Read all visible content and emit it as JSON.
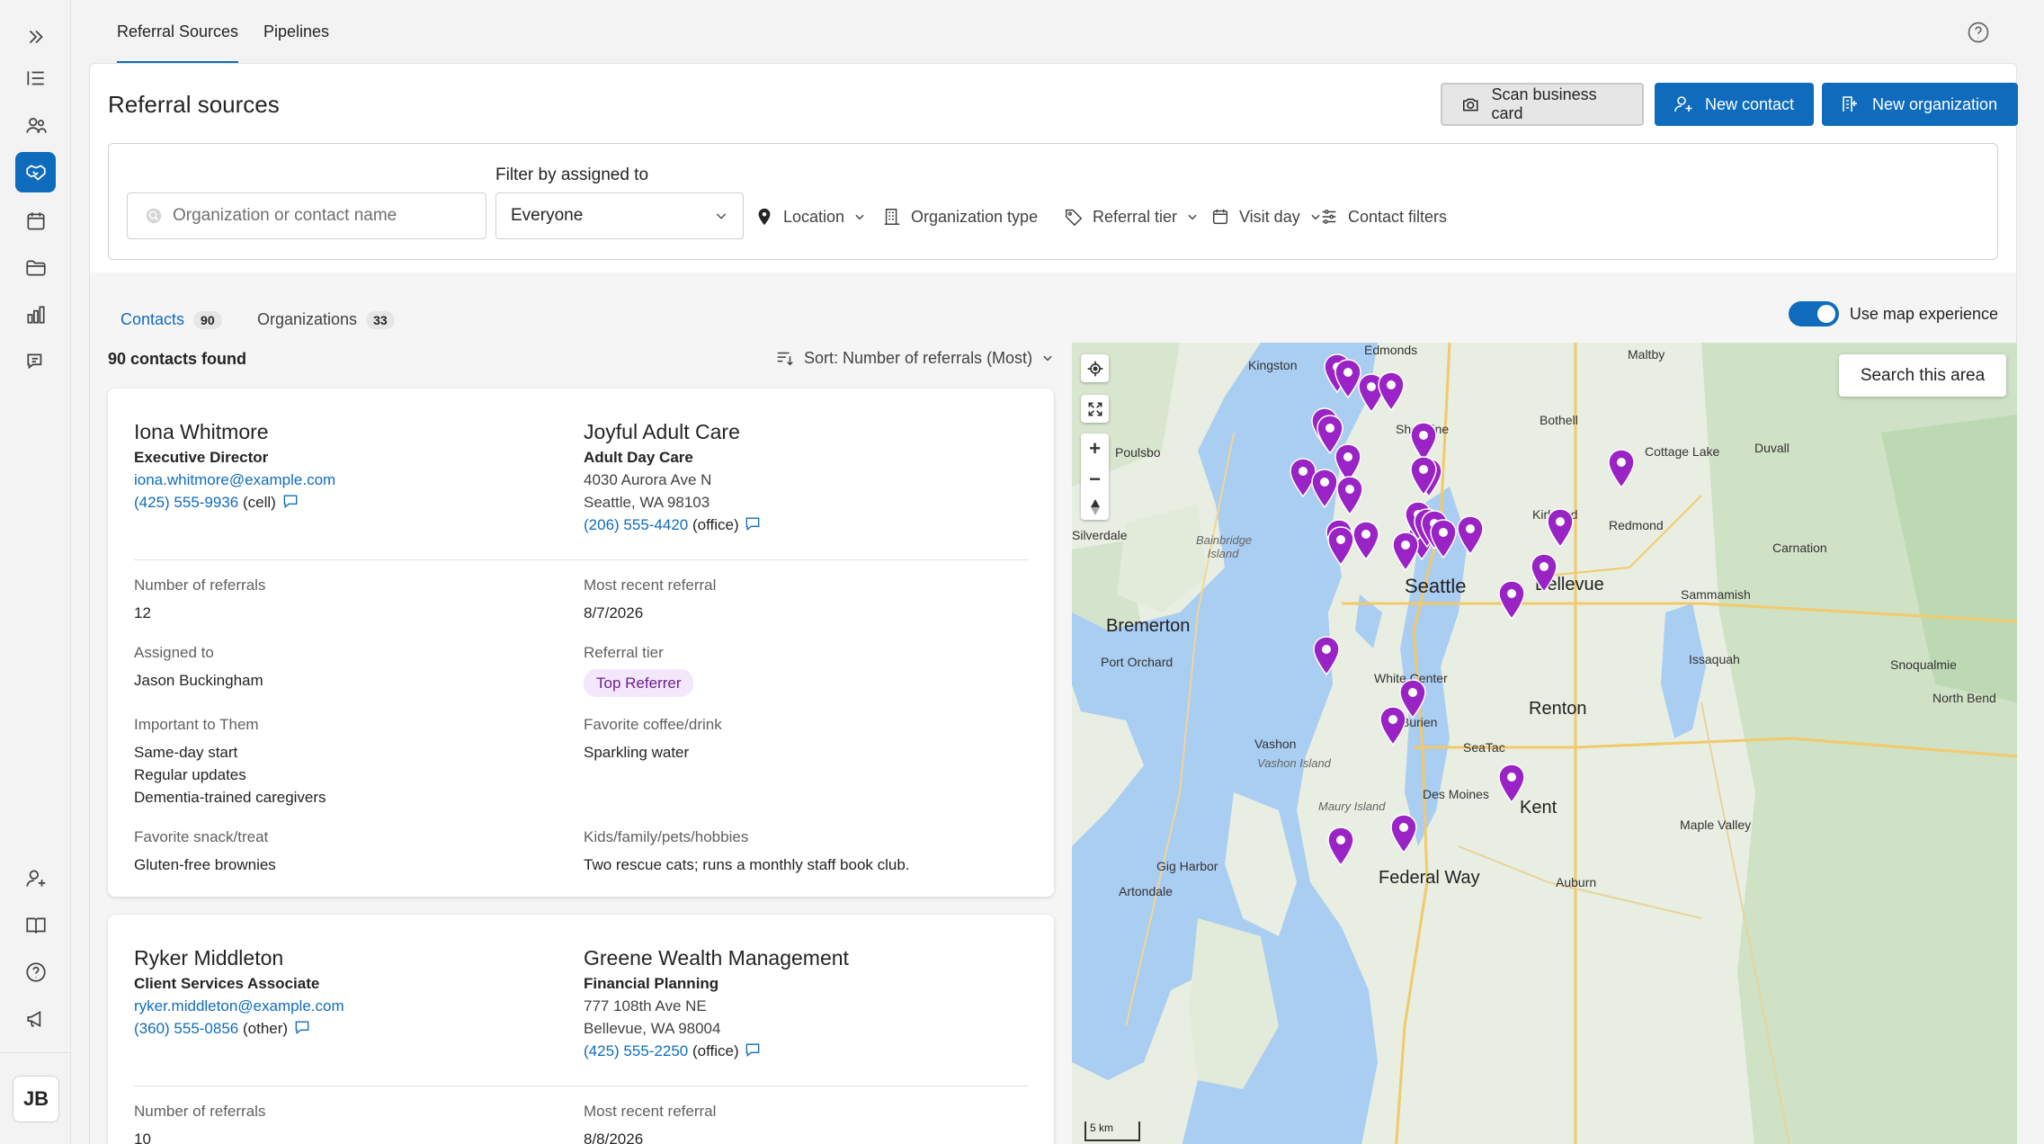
{
  "rail": {
    "items": [
      "expand-icon",
      "list-icon",
      "people-icon",
      "handshake-icon",
      "calendar-icon",
      "folder-icon",
      "chart-icon",
      "chat-icon"
    ],
    "bottom": [
      "person-add-icon",
      "book-icon",
      "help-icon",
      "megaphone-icon"
    ],
    "avatar": "JB"
  },
  "topnav": {
    "tabs": [
      "Referral Sources",
      "Pipelines"
    ]
  },
  "header": {
    "title": "Referral sources",
    "scan_label": "Scan business card",
    "new_contact_label": "New contact",
    "new_org_label": "New organization"
  },
  "filters": {
    "search_placeholder": "Organization or contact name",
    "assigned_label": "Filter by assigned to",
    "assigned_value": "Everyone",
    "chips": [
      "Location",
      "Organization type",
      "Referral tier",
      "Visit day",
      "Contact filters"
    ]
  },
  "list": {
    "contacts_label": "Contacts",
    "contacts_count": "90",
    "orgs_label": "Organizations",
    "orgs_count": "33",
    "map_toggle_label": "Use map experience",
    "found_text": "90 contacts found",
    "sort_label": "Sort: Number of referrals (Most)"
  },
  "cards": [
    {
      "name": "Iona Whitmore",
      "role": "Executive Director",
      "email": "iona.whitmore@example.com",
      "phone": "(425) 555-9936",
      "phone_type": "(cell)",
      "org": "Joyful Adult Care",
      "org_type": "Adult Day Care",
      "addr1": "4030 Aurora Ave N",
      "addr2": "Seattle, WA 98103",
      "org_phone": "(206) 555-4420",
      "org_phone_type": "(office)",
      "referrals_label": "Number of referrals",
      "referrals": "12",
      "recent_label": "Most recent referral",
      "recent": "8/7/2026",
      "assigned_label": "Assigned to",
      "assigned": "Jason Buckingham",
      "tier_label": "Referral tier",
      "tier": "Top Referrer",
      "important_label": "Important to Them",
      "important": [
        "Same-day start",
        "Regular updates",
        "Dementia-trained caregivers"
      ],
      "coffee_label": "Favorite coffee/drink",
      "coffee": "Sparkling water",
      "snack_label": "Favorite snack/treat",
      "snack": "Gluten-free brownies",
      "hobbies_label": "Kids/family/pets/hobbies",
      "hobbies": "Two rescue cats; runs a monthly staff book club."
    },
    {
      "name": "Ryker Middleton",
      "role": "Client Services Associate",
      "email": "ryker.middleton@example.com",
      "phone": "(360) 555-0856",
      "phone_type": "(other)",
      "org": "Greene Wealth Management",
      "org_type": "Financial Planning",
      "addr1": "777 108th Ave NE",
      "addr2": "Bellevue, WA 98004",
      "org_phone": "(425) 555-2250",
      "org_phone_type": "(office)",
      "referrals_label": "Number of referrals",
      "referrals": "10",
      "recent_label": "Most recent referral",
      "recent": "8/8/2026"
    }
  ],
  "map": {
    "search_area_label": "Search this area",
    "scale_label": "5 km",
    "places": {
      "edmonds": "Edmonds",
      "kingston": "Kingston",
      "maltby": "Maltby",
      "shoreline": "Shoreline",
      "bothell": "Bothell",
      "poulsbo": "Poulsbo",
      "cottage": "Cottage Lake",
      "duvall": "Duvall",
      "kirkland": "Kirkland",
      "redmond": "Redmond",
      "silverdale": "Silverdale",
      "bainbridge": "Bainbridge Island",
      "carnation": "Carnation",
      "seattle": "Seattle",
      "bellevue": "Bellevue",
      "sammamish": "Sammamish",
      "bremerton": "Bremerton",
      "port_orchard": "Port Orchard",
      "issaquah": "Issaquah",
      "snoqualmie": "Snoqualmie",
      "white_center": "White Center",
      "north_bend": "North Bend",
      "burien": "Burien",
      "renton": "Renton",
      "vashon": "Vashon",
      "vashon_island": "Vashon Island",
      "seatac": "SeaTac",
      "des_moines": "Des Moines",
      "kent": "Kent",
      "maury": "Maury Island",
      "maple_valley": "Maple Valley",
      "gig_harbor": "Gig Harbor",
      "federal_way": "Federal Way",
      "auburn": "Auburn",
      "artondale": "Artondale"
    },
    "pin_color": "#9a23c5"
  }
}
